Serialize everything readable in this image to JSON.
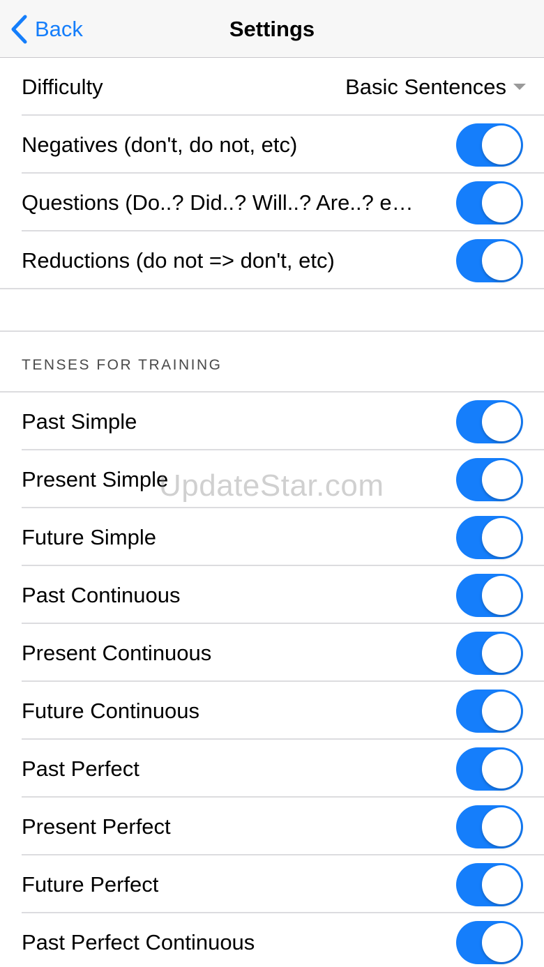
{
  "nav": {
    "back_label": "Back",
    "title": "Settings"
  },
  "options": {
    "difficulty_label": "Difficulty",
    "difficulty_value": "Basic Sentences",
    "toggles": [
      {
        "label": "Negatives (don't, do not, etc)",
        "on": true
      },
      {
        "label": "Questions (Do..? Did..? Will..? Are..? e…",
        "on": true
      },
      {
        "label": "Reductions (do not => don't, etc)",
        "on": true
      }
    ]
  },
  "tenses": {
    "header": "TENSES FOR TRAINING",
    "items": [
      {
        "label": "Past Simple",
        "on": true
      },
      {
        "label": "Present Simple",
        "on": true
      },
      {
        "label": "Future Simple",
        "on": true
      },
      {
        "label": "Past Continuous",
        "on": true
      },
      {
        "label": "Present Continuous",
        "on": true
      },
      {
        "label": "Future Continuous",
        "on": true
      },
      {
        "label": "Past Perfect",
        "on": true
      },
      {
        "label": "Present Perfect",
        "on": true
      },
      {
        "label": "Future Perfect",
        "on": true
      },
      {
        "label": "Past Perfect Continuous",
        "on": true
      }
    ]
  },
  "watermark": "UpdateStar.com",
  "colors": {
    "accent": "#157efb",
    "nav_background": "#f7f7f7",
    "separator": "#dcdcdf"
  }
}
